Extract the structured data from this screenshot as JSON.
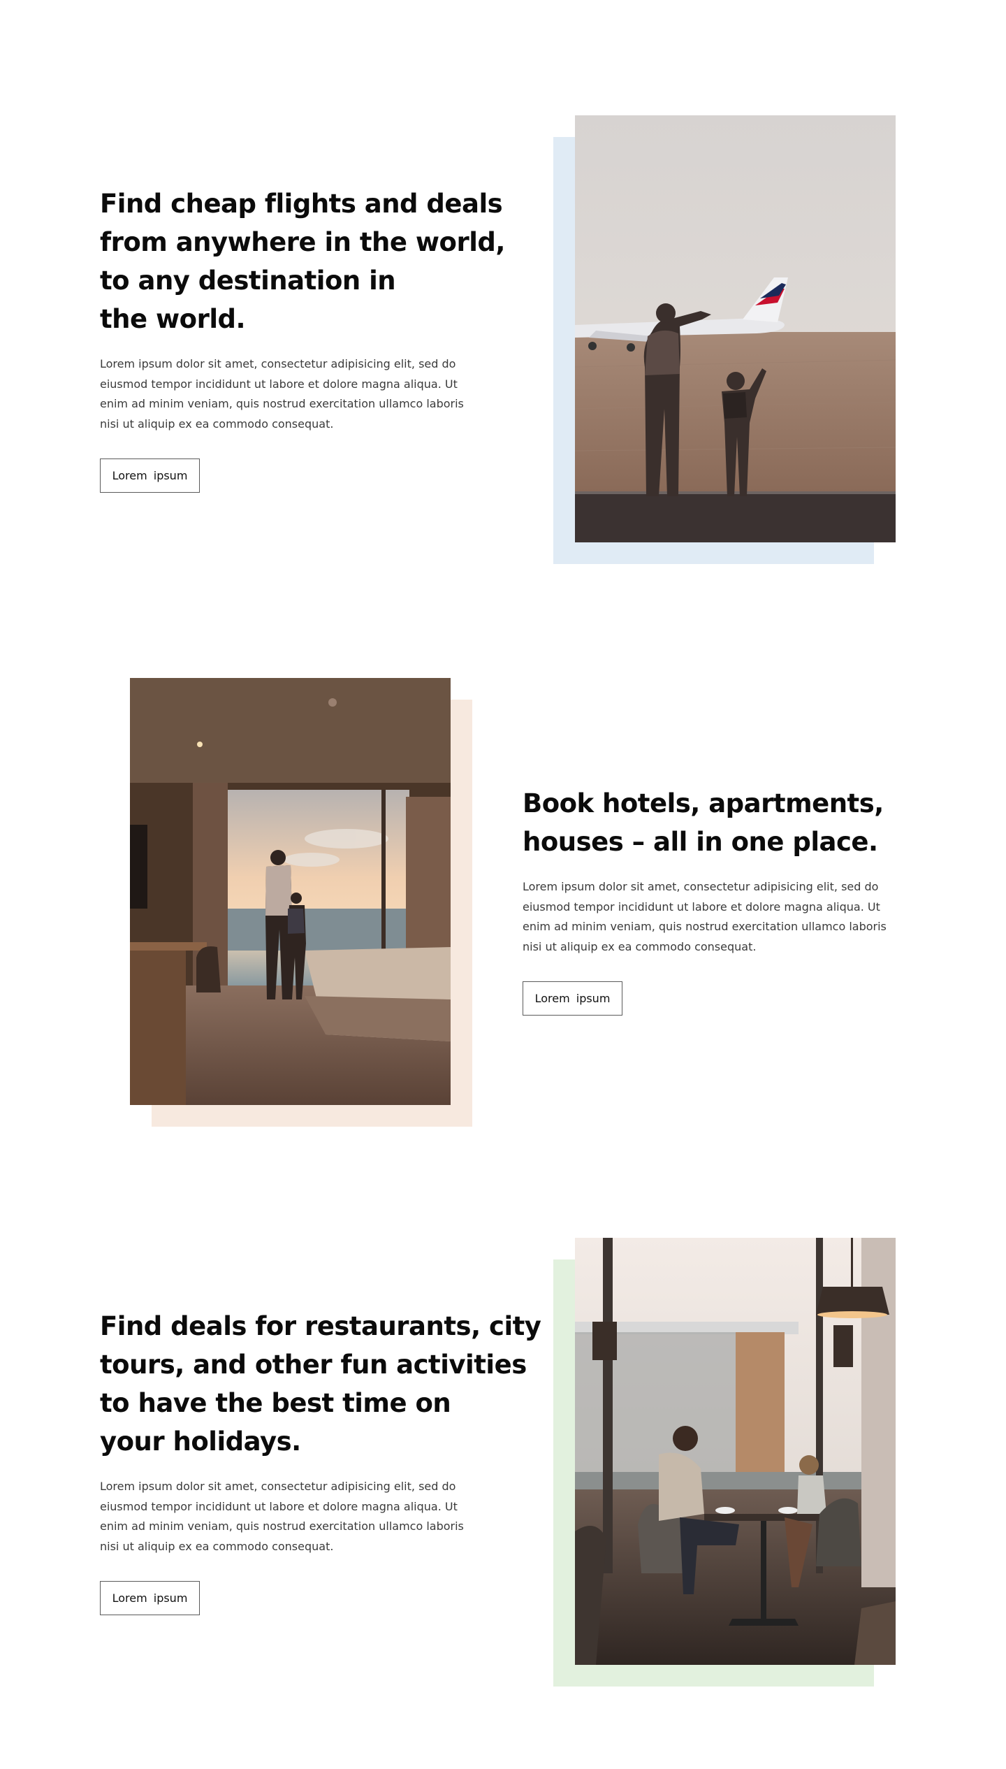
{
  "colors": {
    "backdrop_blue": "#e0ebf5",
    "backdrop_peach": "#f7e9df",
    "backdrop_green": "#e2f1de",
    "heading": "#0b0b0b",
    "body_text": "#3a3a3a",
    "button_border": "#5a5a5a"
  },
  "sections": [
    {
      "heading_lines": [
        "Find cheap flights and deals",
        "from anywhere in the world,",
        "to any destination in",
        "the world."
      ],
      "body_lines": [
        "Lorem ipsum dolor sit amet, consectetur adipisicing elit, sed do",
        "eiusmod tempor incididunt ut labore et dolore magna aliqua. Ut",
        "enim ad minim veniam, quis nostrud exercitation ullamco laboris",
        "nisi ut aliquip ex ea commodo consequat."
      ],
      "button_label": "Lorem ipsum",
      "image": "father-and-son-watching-airplane-photo"
    },
    {
      "heading_lines": [
        "Book hotels, apartments,",
        "houses – all in one place."
      ],
      "body_lines": [
        "Lorem ipsum dolor sit amet, consectetur adipisicing elit, sed do",
        "eiusmod tempor incididunt ut labore et dolore magna aliqua. Ut",
        "enim ad minim veniam, quis nostrud exercitation ullamco laboris",
        "nisi ut aliquip ex ea commodo consequat."
      ],
      "button_label": "Lorem ipsum",
      "image": "father-and-son-hotel-room-photo"
    },
    {
      "heading_lines": [
        "Find deals for restaurants, city",
        "tours, and other fun activities",
        "to have the best time on",
        "your holidays."
      ],
      "body_lines": [
        "Lorem ipsum dolor sit amet, consectetur adipisicing elit, sed do",
        "eiusmod tempor incididunt ut labore et dolore magna aliqua. Ut",
        "enim ad minim veniam, quis nostrud exercitation ullamco laboris",
        "nisi ut aliquip ex ea commodo consequat."
      ],
      "button_label": "Lorem ipsum",
      "image": "father-and-son-restaurant-photo"
    }
  ]
}
